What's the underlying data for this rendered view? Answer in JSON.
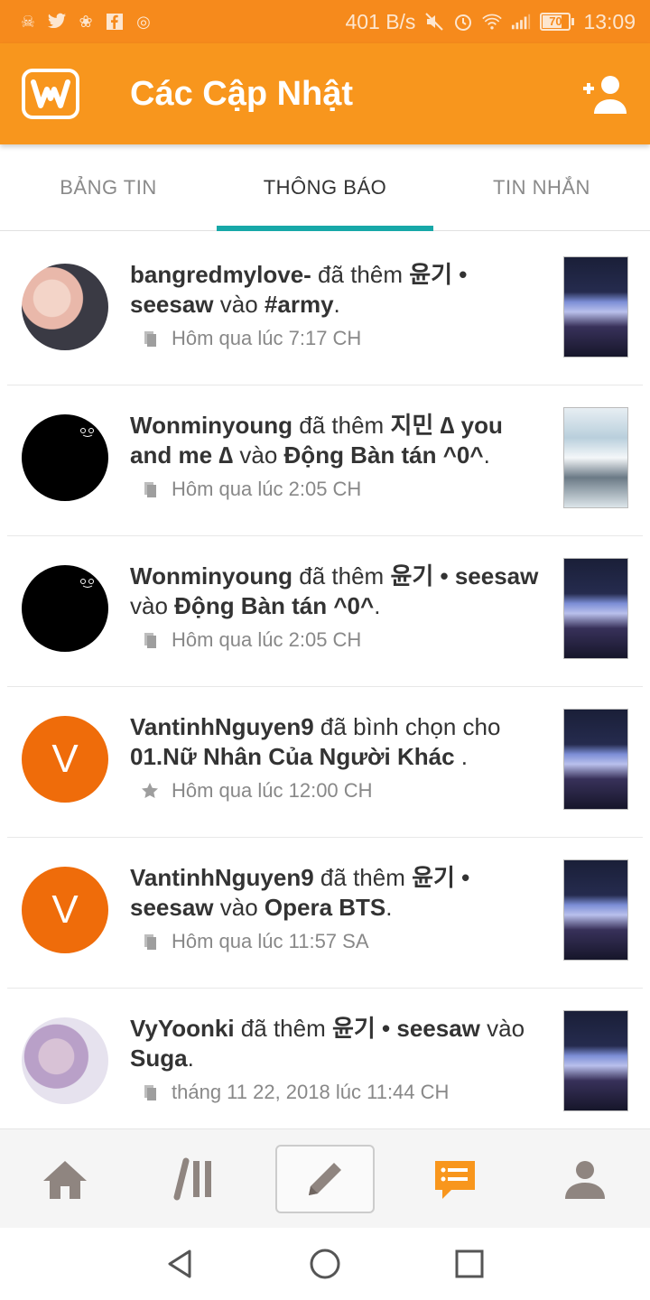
{
  "status_bar": {
    "net_speed": "401 B/s",
    "battery_level": "70",
    "time": "13:09"
  },
  "app_bar": {
    "title": "Các Cập Nhật"
  },
  "tabs": [
    {
      "label": "BẢNG TIN",
      "active": false
    },
    {
      "label": "THÔNG BÁO",
      "active": true
    },
    {
      "label": "TIN NHẮN",
      "active": false
    }
  ],
  "notifications": [
    {
      "user": "bangredmylove-",
      "action": " đã thêm ",
      "story": "윤기 • seesaw",
      "connector": " vào ",
      "target": "#army",
      "suffix": ".",
      "time": "Hôm qua lúc 7:17 CH",
      "icon": "library-icon"
    },
    {
      "user": "Wonminyoung",
      "action": " đã thêm ",
      "story": "지민 ∆ you and me ∆",
      "connector": " vào ",
      "target": "Động Bàn tán ^0^",
      "suffix": ".",
      "time": "Hôm qua lúc 2:05 CH",
      "icon": "library-icon"
    },
    {
      "user": "Wonminyoung",
      "action": " đã thêm ",
      "story": "윤기 • seesaw",
      "connector": " vào ",
      "target": "Động Bàn tán ^0^",
      "suffix": ".",
      "time": "Hôm qua lúc 2:05 CH",
      "icon": "library-icon"
    },
    {
      "user": "VantinhNguyen9",
      "action": " đã bình chọn cho ",
      "story": "01.Nữ Nhân Của Người Khác",
      "connector": "",
      "target": "",
      "suffix": " .",
      "time": "Hôm qua lúc 12:00 CH",
      "icon": "star-icon",
      "avatar_letter": "V"
    },
    {
      "user": "VantinhNguyen9",
      "action": " đã thêm ",
      "story": "윤기 • seesaw",
      "connector": " vào ",
      "target": "Opera BTS",
      "suffix": ".",
      "time": "Hôm qua lúc 11:57 SA",
      "icon": "library-icon",
      "avatar_letter": "V"
    },
    {
      "user": "VyYoonki",
      "action": " đã thêm ",
      "story": "윤기 • seesaw",
      "connector": " vào ",
      "target": "Suga",
      "suffix": ".",
      "time": "tháng 11 22, 2018 lúc 11:44 CH",
      "icon": "library-icon"
    }
  ],
  "colors": {
    "status_bar": "#f68a1c",
    "app_bar": "#f8961d",
    "tab_indicator": "#17a8a8",
    "avatar_orange": "#ef6c0a",
    "nav_active": "#f8961d"
  }
}
